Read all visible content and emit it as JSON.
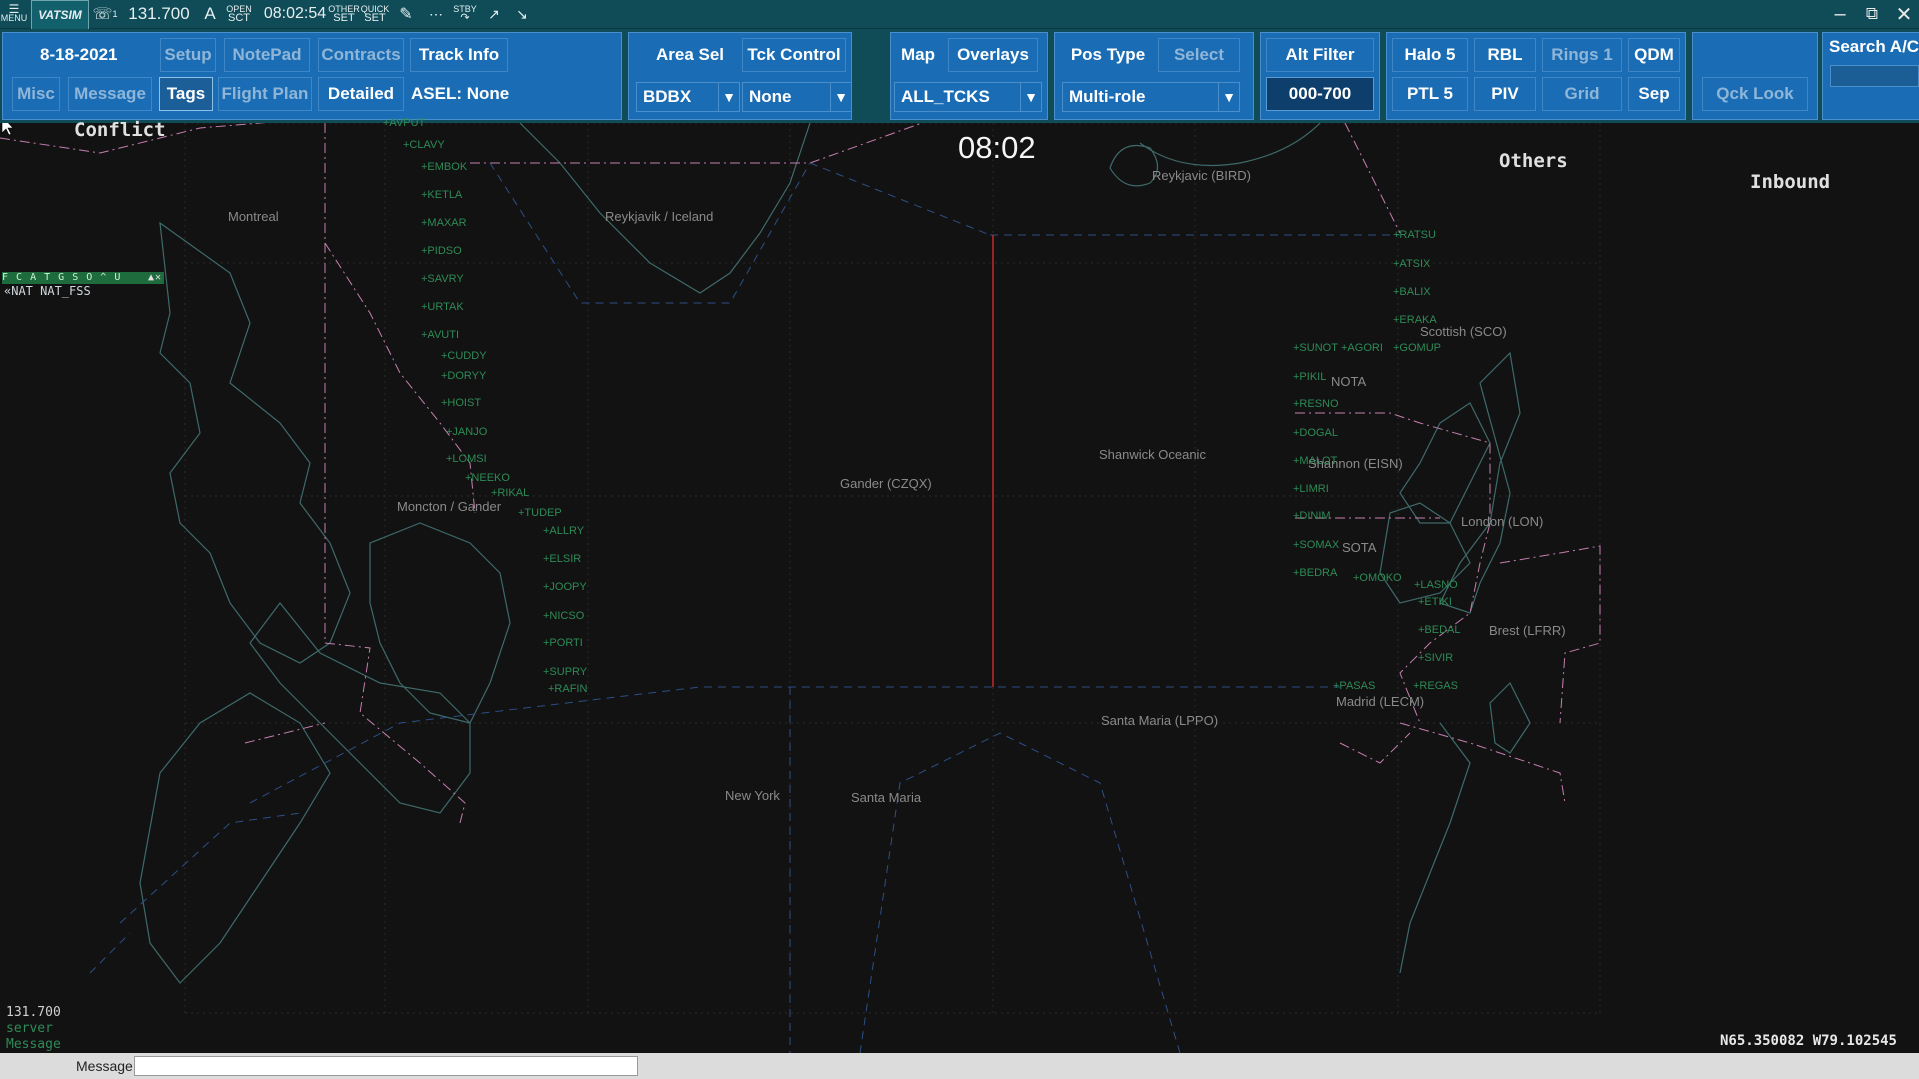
{
  "statusbar": {
    "menu_label": "MENU",
    "logo_text": "VATSIM",
    "headset_count": "1",
    "frequency": "131.700",
    "atis_letter": "A",
    "open_label_top": "OPEN",
    "open_label_bottom": "SCT",
    "time": "08:02:54",
    "other_top": "OTHER",
    "other_bottom": "SET",
    "quick_top": "QUICK",
    "quick_bottom": "SET",
    "stby_top": "STBY"
  },
  "toolbar": {
    "date": "8-18-2021",
    "setup": "Setup",
    "notepad": "NotePad",
    "contracts": "Contracts",
    "track_info": "Track Info",
    "misc": "Misc",
    "message": "Message",
    "tags": "Tags",
    "flight_plan": "Flight Plan",
    "detailed": "Detailed",
    "asel": "ASEL: None",
    "area_sel": "Area Sel",
    "tck_control": "Tck Control",
    "area_value": "BDBX",
    "tck_value": "None",
    "map": "Map",
    "overlays": "Overlays",
    "map_value": "ALL_TCKS",
    "pos_type": "Pos Type",
    "select": "Select",
    "pos_value": "Multi-role",
    "alt_filter": "Alt Filter",
    "alt_value": "000-700",
    "halo": "Halo 5",
    "rbl": "RBL",
    "rings": "Rings 1",
    "qdm": "QDM",
    "ptl": "PTL 5",
    "piv": "PIV",
    "grid": "Grid",
    "sep": "Sep",
    "qck_look": "Qck Look",
    "search": "Search A/C"
  },
  "scope": {
    "conflict": "Conflict",
    "clock": "08:02",
    "others": "Others",
    "inbound": "Inbound",
    "list_header": "F C A T G S O ^ U",
    "list_row": "«NAT NAT_FSS",
    "coords": "N65.350082 W79.102545",
    "freq_line1": "131.700",
    "freq_line2": "server",
    "freq_line3": "Message"
  },
  "fir_labels": {
    "montreal": "Montreal",
    "reykjavik_iceland": "Reykjavik / Iceland",
    "reykjavik_bird": "Reykjavic (BIRD)",
    "moncton_gander": "Moncton / Gander",
    "gander": "Gander (CZQX)",
    "shanwick": "Shanwick Oceanic",
    "scottish": "Scottish (SCO)",
    "nota": "NOTA",
    "shannon": "Shannon (EISN)",
    "sota": "SOTA",
    "london": "London (LON)",
    "brest": "Brest (LFRR)",
    "madrid": "Madrid (LECM)",
    "santa_maria_lppo": "Santa Maria (LPPO)",
    "new_york": "New York",
    "santa_maria": "Santa Maria"
  },
  "waypoints_west": [
    "AVPUT",
    "CLAVY",
    "EMBOK",
    "KETLA",
    "MAXAR",
    "PIDSO",
    "SAVRY",
    "URTAK",
    "AVUTI",
    "CUDDY",
    "DORYY",
    "HOIST",
    "JANJO",
    "LOMSI",
    "NEEKO",
    "RIKAL",
    "TUDEP",
    "ALLRY",
    "ELSIR",
    "JOOPY",
    "NICSO",
    "PORTI",
    "SUPRY",
    "RAFIN"
  ],
  "waypoints_east": [
    "RATSU",
    "ATSIX",
    "BALIX",
    "ERAKA",
    "GOMUP",
    "SUNOT",
    "AGORI",
    "PIKIL",
    "RESNO",
    "DOGAL",
    "MALOT",
    "LIMRI",
    "DINIM",
    "SOMAX",
    "BEDRA",
    "OMOKO",
    "LASNO",
    "ETIKI",
    "BEDAL",
    "SIVIR",
    "PASAS",
    "REGAS"
  ],
  "message_bar": {
    "label": "Message",
    "value": ""
  },
  "colors": {
    "toolbar_bg": "#0f4c57",
    "button_bg": "#1a6db5",
    "scope_bg": "#121212",
    "waypoint": "#2e8b57",
    "boundary": "#c77fb0",
    "track_line": "#c62828"
  }
}
